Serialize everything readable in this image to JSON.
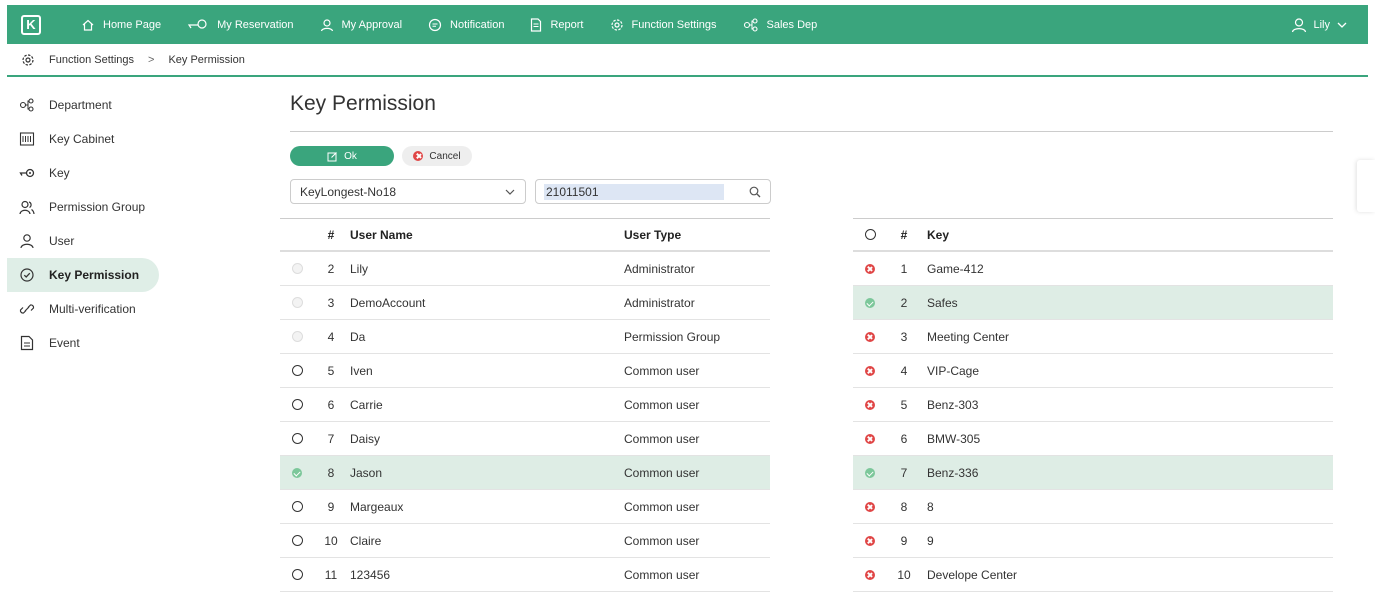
{
  "nav": {
    "items": [
      {
        "label": "Home Page",
        "icon": "home-icon"
      },
      {
        "label": "My Reservation",
        "icon": "key-icon"
      },
      {
        "label": "My Approval",
        "icon": "person-icon"
      },
      {
        "label": "Notification",
        "icon": "chat-icon"
      },
      {
        "label": "Report",
        "icon": "document-icon"
      },
      {
        "label": "Function Settings",
        "icon": "gear-icon"
      },
      {
        "label": "Sales Dep",
        "icon": "org-icon"
      }
    ],
    "user": "Lily"
  },
  "breadcrumb": {
    "parent": "Function Settings",
    "sep": ">",
    "current": "Key Permission"
  },
  "sidebar": {
    "items": [
      {
        "label": "Department",
        "icon": "org-icon"
      },
      {
        "label": "Key Cabinet",
        "icon": "cabinet-icon"
      },
      {
        "label": "Key",
        "icon": "key-icon"
      },
      {
        "label": "Permission Group",
        "icon": "group-icon"
      },
      {
        "label": "User",
        "icon": "person-icon"
      },
      {
        "label": "Key Permission",
        "icon": "shield-icon",
        "active": true
      },
      {
        "label": "Multi-verification",
        "icon": "link-icon"
      },
      {
        "label": "Event",
        "icon": "document-icon"
      }
    ]
  },
  "main": {
    "title": "Key Permission",
    "ok_label": "Ok",
    "cancel_label": "Cancel",
    "cabinet_select": "KeyLongest-No18",
    "search_value": "21011501"
  },
  "users_table": {
    "headers": {
      "num": "#",
      "name": "User Name",
      "type": "User Type"
    },
    "rows": [
      {
        "num": "2",
        "name": "Lily",
        "type": "Administrator",
        "state": "disabled"
      },
      {
        "num": "3",
        "name": "DemoAccount",
        "type": "Administrator",
        "state": "disabled"
      },
      {
        "num": "4",
        "name": "Da",
        "type": "Permission Group",
        "state": "disabled"
      },
      {
        "num": "5",
        "name": "Iven",
        "type": "Common user",
        "state": "unchecked"
      },
      {
        "num": "6",
        "name": "Carrie",
        "type": "Common user",
        "state": "unchecked"
      },
      {
        "num": "7",
        "name": "Daisy",
        "type": "Common user",
        "state": "unchecked"
      },
      {
        "num": "8",
        "name": "Jason",
        "type": "Common user",
        "state": "checked"
      },
      {
        "num": "9",
        "name": "Margeaux",
        "type": "Common user",
        "state": "unchecked"
      },
      {
        "num": "10",
        "name": "Claire",
        "type": "Common user",
        "state": "unchecked"
      },
      {
        "num": "11",
        "name": "123456",
        "type": "Common user",
        "state": "unchecked"
      }
    ]
  },
  "keys_table": {
    "headers": {
      "num": "#",
      "key": "Key"
    },
    "rows": [
      {
        "num": "1",
        "key": "Game-412",
        "state": "denied"
      },
      {
        "num": "2",
        "key": "Safes",
        "state": "granted"
      },
      {
        "num": "3",
        "key": "Meeting Center",
        "state": "denied"
      },
      {
        "num": "4",
        "key": "VIP-Cage",
        "state": "denied"
      },
      {
        "num": "5",
        "key": "Benz-303",
        "state": "denied"
      },
      {
        "num": "6",
        "key": "BMW-305",
        "state": "denied"
      },
      {
        "num": "7",
        "key": "Benz-336",
        "state": "granted"
      },
      {
        "num": "8",
        "key": "8",
        "state": "denied"
      },
      {
        "num": "9",
        "key": "9",
        "state": "denied"
      },
      {
        "num": "10",
        "key": "Develope Center",
        "state": "denied"
      }
    ]
  },
  "colors": {
    "accent": "#3aa57d",
    "selected_row": "#deede5",
    "denied": "#e04646",
    "granted": "#7cc79a"
  }
}
